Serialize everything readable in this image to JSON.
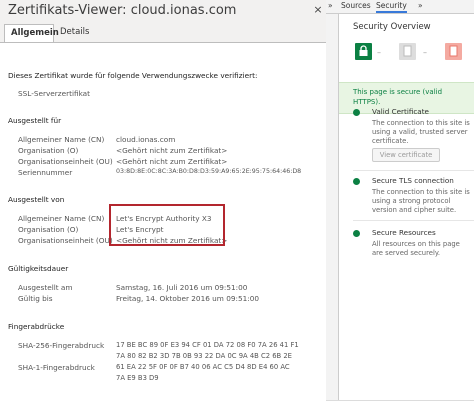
{
  "dialog": {
    "title": "Zertifikats-Viewer: cloud.ionas.com",
    "close": "×",
    "tabs": [
      "Allgemein",
      "Details"
    ],
    "intro": "Dieses Zertifikat wurde für folgende Verwendungszwecke verifiziert:",
    "purpose": "SSL-Serverzertifikat",
    "issued_to": {
      "heading": "Ausgestellt für",
      "rows": [
        {
          "label": "Allgemeiner Name (CN)",
          "value": "cloud.ionas.com"
        },
        {
          "label": "Organisation (O)",
          "value": "<Gehört nicht zum Zertifikat>"
        },
        {
          "label": "Organisationseinheit (OU)",
          "value": "<Gehört nicht zum Zertifikat>"
        },
        {
          "label": "Seriennummer",
          "value": "03:8D:8E:0C:8C:3A:B0:D8:D3:59:A9:65:2E:95:75:64:46:D8"
        }
      ]
    },
    "issued_by": {
      "heading": "Ausgestellt von",
      "rows": [
        {
          "label": "Allgemeiner Name (CN)",
          "value": "Let's Encrypt Authority X3"
        },
        {
          "label": "Organisation (O)",
          "value": "Let's Encrypt"
        },
        {
          "label": "Organisationseinheit (OU)",
          "value": "<Gehört nicht zum Zertifikat>"
        }
      ]
    },
    "validity": {
      "heading": "Gültigkeitsdauer",
      "rows": [
        {
          "label": "Ausgestellt am",
          "value": "Samstag, 16. Juli 2016 um 09:51:00"
        },
        {
          "label": "Gültig bis",
          "value": "Freitag, 14. Oktober 2016 um 09:51:00"
        }
      ]
    },
    "fingerprints": {
      "heading": "Fingerabdrücke",
      "sha256_label": "SHA-256-Fingerabdruck",
      "sha256_line1": "17 BE BC 89 0F E3 94 CF 01 DA 72 08 F0 7A 26 41 F1",
      "sha256_line2": "7A 80 82 B2 3D 7B 0B 93 22 DA 0C 9A 4B C2 6B 2E",
      "sha1_label": "SHA-1-Fingerabdruck",
      "sha1_line1": "61 EA 22 5F 0F 0F B7 40 06 AC C5 D4 8D E4 60 AC",
      "sha1_line2": "7A E9 B3 D9"
    }
  },
  "devtools": {
    "tabs": [
      "Sources",
      "Security"
    ],
    "more": "»",
    "overview_title": "Security Overview",
    "secure_message": "This page is secure (valid HTTPS).",
    "items": [
      {
        "title": "Valid Certificate",
        "desc": "The connection to this site is using a valid, trusted server certificate.",
        "button": "View certificate"
      },
      {
        "title": "Secure TLS connection",
        "desc": "The connection to this site is using a strong protocol version and cipher suite."
      },
      {
        "title": "Secure Resources",
        "desc": "All resources on this page are served securely."
      }
    ],
    "colors": {
      "secure_green": "#0b8043",
      "insecure_red": "#f4aaa1",
      "tab_accent": "#3879d9"
    }
  }
}
